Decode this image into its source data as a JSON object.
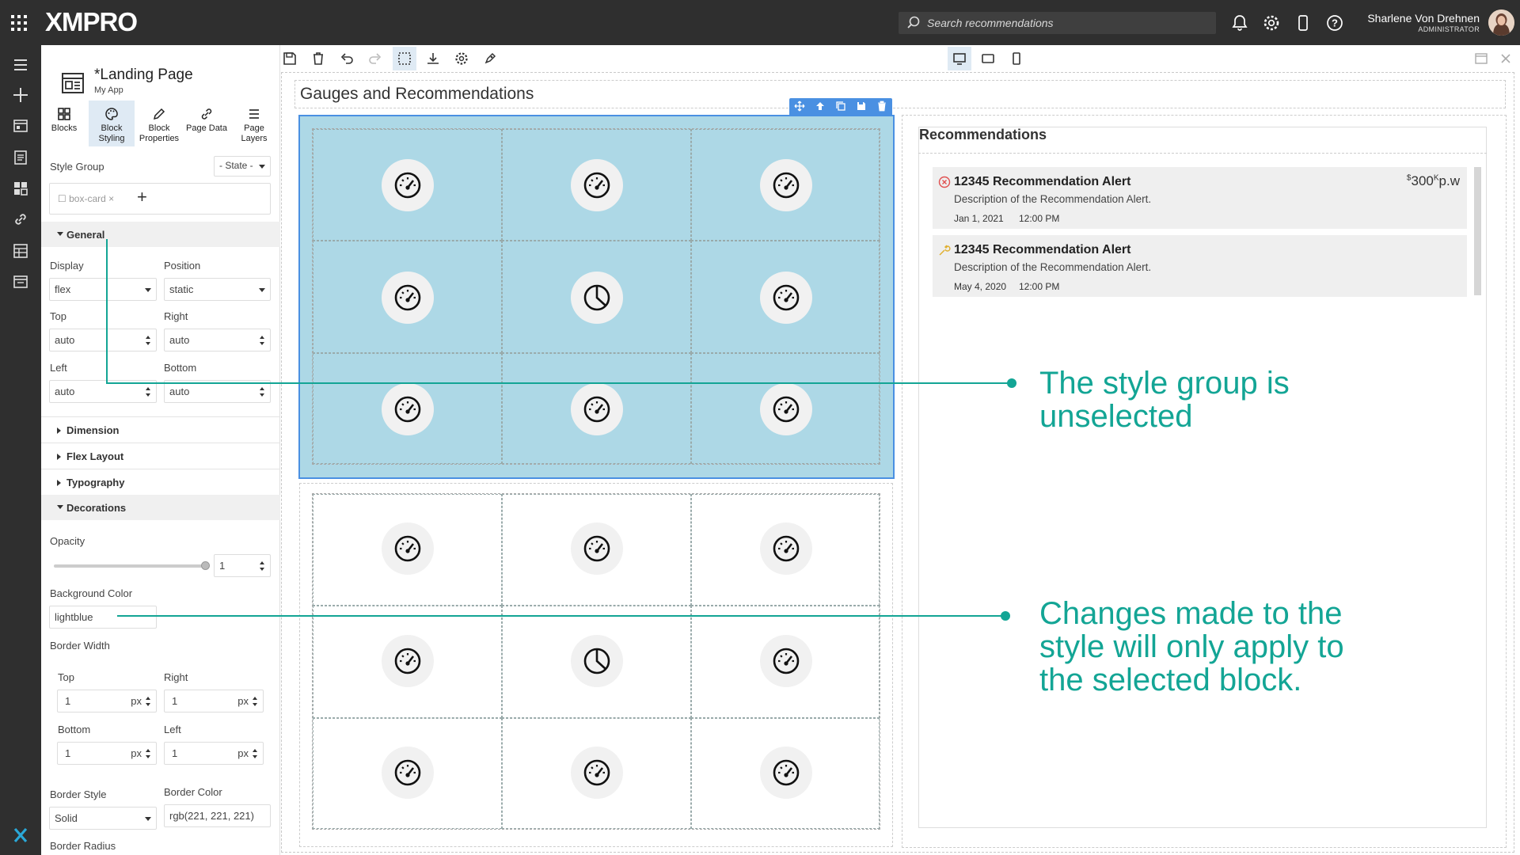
{
  "app": {
    "brand": "XMPRO",
    "search_placeholder": "Search recommendations",
    "user_name": "Sharlene Von Drehnen",
    "user_role": "ADMINISTRATOR"
  },
  "page": {
    "title": "*Landing Page",
    "subtitle": "My App"
  },
  "panel_tabs": [
    {
      "label": "Blocks",
      "icon": "blocks-icon"
    },
    {
      "label": "Block Styling",
      "icon": "palette-icon"
    },
    {
      "label": "Block Properties",
      "icon": "pencil-icon"
    },
    {
      "label": "Page Data",
      "icon": "link-icon"
    },
    {
      "label": "Page Layers",
      "icon": "layers-icon"
    }
  ],
  "style_group": {
    "label": "Style Group",
    "state_label": "- State -",
    "chip": "box-card"
  },
  "sections": {
    "general": "General",
    "dimension": "Dimension",
    "flex_layout": "Flex Layout",
    "typography": "Typography",
    "decorations": "Decorations"
  },
  "general": {
    "display_label": "Display",
    "display_value": "flex",
    "position_label": "Position",
    "position_value": "static",
    "top_label": "Top",
    "top_value": "auto",
    "right_label": "Right",
    "right_value": "auto",
    "left_label": "Left",
    "left_value": "auto",
    "bottom_label": "Bottom",
    "bottom_value": "auto"
  },
  "decorations": {
    "opacity_label": "Opacity",
    "opacity_value": "1",
    "bg_label": "Background Color",
    "bg_value": "lightblue",
    "border_width_label": "Border Width",
    "bw_top_label": "Top",
    "bw_top_value": "1",
    "bw_right_label": "Right",
    "bw_right_value": "1",
    "bw_bottom_label": "Bottom",
    "bw_bottom_value": "1",
    "bw_left_label": "Left",
    "bw_left_value": "1",
    "unit": "px",
    "border_style_label": "Border Style",
    "border_style_value": "Solid",
    "border_color_label": "Border Color",
    "border_color_value": "rgb(221, 221, 221)",
    "border_radius_label": "Border Radius"
  },
  "canvas": {
    "heading": "Gauges and Recommendations"
  },
  "recommendations": {
    "title": "Recommendations",
    "items": [
      {
        "title": "12345 Recommendation Alert",
        "description": "Description of the Recommendation Alert.",
        "date": "Jan 1, 2021",
        "time": "12:00 PM",
        "price_symbol": "$",
        "price": "300",
        "price_super": "K",
        "price_unit": "p.w",
        "icon": "error-circle-icon"
      },
      {
        "title": "12345 Recommendation Alert",
        "description": "Description of the Recommendation Alert.",
        "date": "May 4, 2020",
        "time": "12:00 PM",
        "icon": "wrench-icon"
      }
    ]
  },
  "callouts": [
    {
      "text_line1": "The style group is",
      "text_line2": "unselected"
    },
    {
      "text_line1": "Changes made to the",
      "text_line2": "style will only apply to",
      "text_line3": "the selected block."
    }
  ],
  "colors": {
    "topbar": "#2f2f2f",
    "accent": "#4a90e2",
    "selected_block": "#add8e6",
    "callout": "#13a595"
  }
}
